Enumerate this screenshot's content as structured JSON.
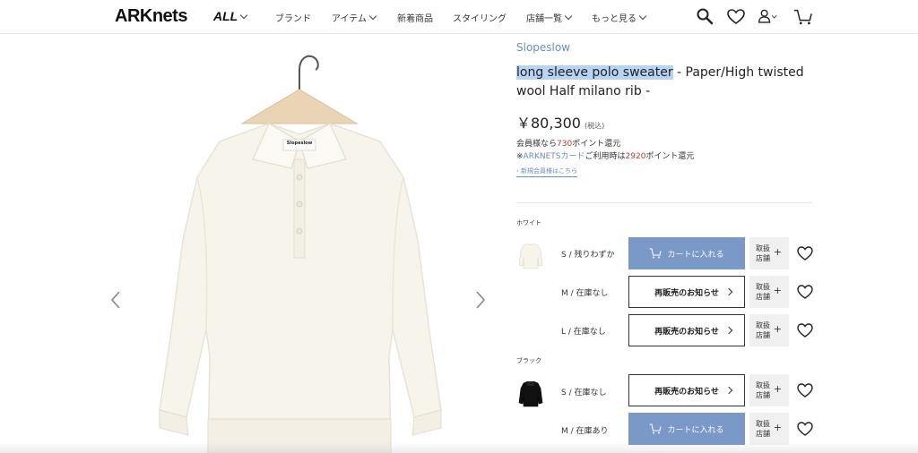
{
  "header": {
    "logo": "ARKnets",
    "all_menu": "ALL",
    "nav": [
      {
        "label": "ブランド",
        "has_chevron": false
      },
      {
        "label": "アイテム",
        "has_chevron": true
      },
      {
        "label": "新着商品",
        "has_chevron": false
      },
      {
        "label": "スタイリング",
        "has_chevron": false
      },
      {
        "label": "店舗一覧",
        "has_chevron": true
      },
      {
        "label": "もっと見る",
        "has_chevron": true
      }
    ],
    "icons": [
      "search-icon",
      "heart-icon",
      "account-icon",
      "cart-icon"
    ]
  },
  "product": {
    "brand": "Slopeslow",
    "title_highlight": "long sleeve polo sweater",
    "title_rest": " - Paper/High twisted wool Half milano rib -",
    "price": "￥80,300",
    "tax_note": "(税込)",
    "points_line1_pre": "会員様なら",
    "points_line1_value": "730",
    "points_line1_post": "ポイント還元",
    "points_line2_pre": "※",
    "points_line2_card": "ARKNETSカード",
    "points_line2_mid": "ご利用時は",
    "points_line2_value": "2920",
    "points_line2_post": "ポイント還元",
    "new_member_link": "新規会員様はこちら",
    "tag_label": "Slopeslow"
  },
  "variants": [
    {
      "color": "ホワイト",
      "sizes": [
        {
          "label": "S / 残りわずか",
          "button": "カートに入れる",
          "type": "cart"
        },
        {
          "label": "M / 在庫なし",
          "button": "再販売のお知らせ",
          "type": "notify"
        },
        {
          "label": "L / 在庫なし",
          "button": "再販売のお知らせ",
          "type": "notify"
        }
      ]
    },
    {
      "color": "ブラック",
      "sizes": [
        {
          "label": "S / 在庫なし",
          "button": "再販売のお知らせ",
          "type": "notify"
        },
        {
          "label": "M / 在庫あり",
          "button": "カートに入れる",
          "type": "cart"
        }
      ]
    }
  ],
  "store_button": {
    "line1": "取扱",
    "line2": "店舗",
    "plus": "+"
  },
  "colors": {
    "accent_blue": "#7a98c8",
    "link_blue": "#6b8cc0",
    "point_red": "#c0392b",
    "highlight": "#b9d3f3"
  }
}
